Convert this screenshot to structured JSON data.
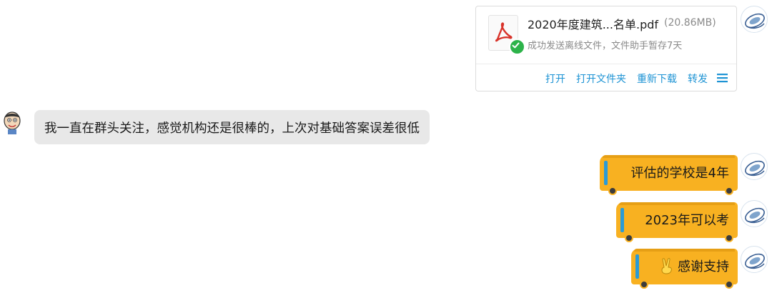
{
  "file_message": {
    "file_name": "2020年度建筑...名单.pdf",
    "file_size": "(20.86MB)",
    "status": "成功发送离线文件，文件助手暂存7天",
    "actions": [
      "打开",
      "打开文件夹",
      "重新下载",
      "转发"
    ]
  },
  "incoming_message": {
    "text": "我一直在群头关注，感觉机构还是很棒的，上次对基础答案误差很低"
  },
  "outgoing_messages": [
    {
      "text": "评估的学校是4年"
    },
    {
      "text": "2023年可以考"
    },
    {
      "text": "感谢支持",
      "emoji": "victory-hand"
    }
  ],
  "colors": {
    "bubble_bus": "#f8b121",
    "bubble_incoming": "#e8e8e8",
    "link": "#1d93d4",
    "check": "#2db34a",
    "pdf_red": "#d8332a"
  }
}
